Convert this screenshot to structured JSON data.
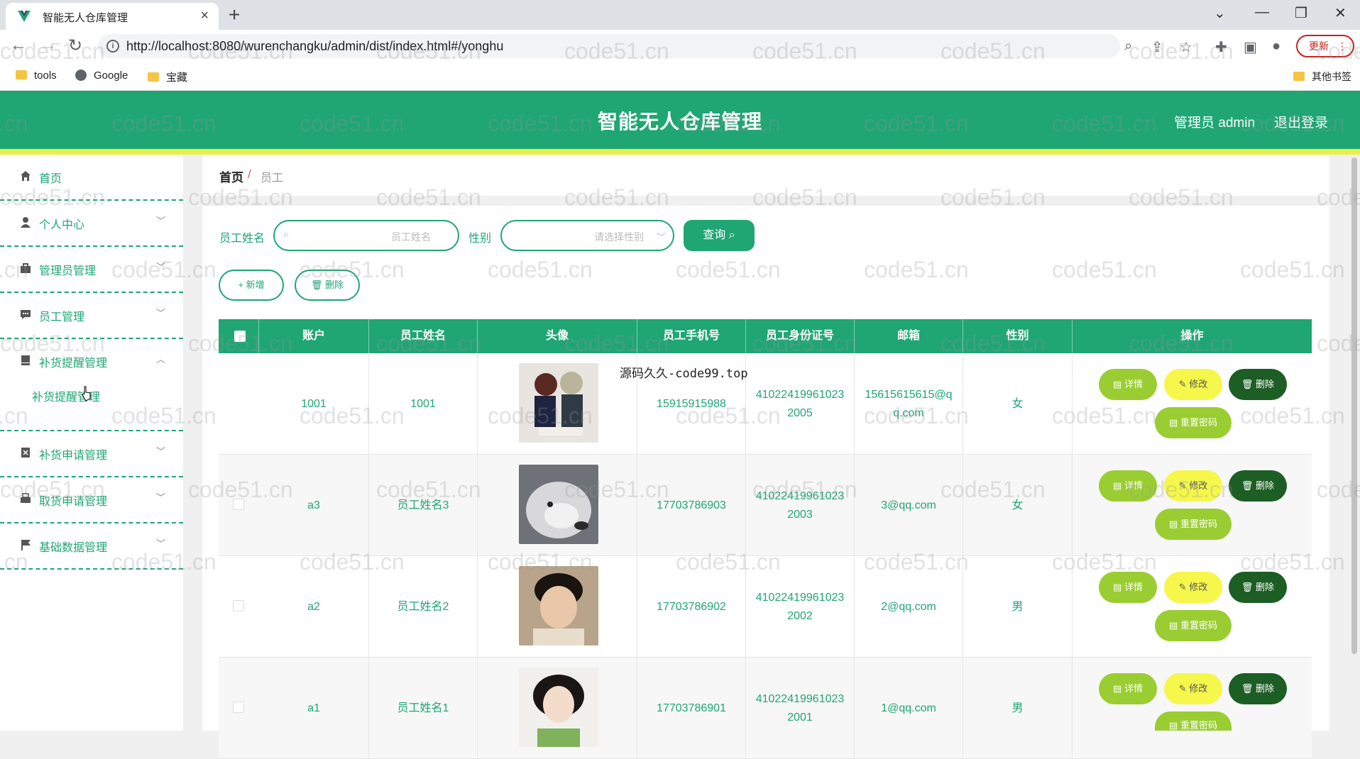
{
  "browser": {
    "tab_title": "智能无人仓库管理",
    "tab_close": "×",
    "new_tab": "+",
    "url": "http://localhost:8080/wurenchangku/admin/dist/index.html#/yonghu",
    "update_label": "更新",
    "menu_dots": "⋮",
    "bookmarks": [
      "tools",
      "Google",
      "宝藏"
    ],
    "other_bookmarks": "其他书签"
  },
  "header": {
    "title": "智能无人仓库管理",
    "user": "管理员 admin",
    "logout": "退出登录"
  },
  "sidebar": {
    "items": [
      {
        "label": "首页",
        "icon": "home-icon"
      },
      {
        "label": "个人中心",
        "icon": "user-icon"
      },
      {
        "label": "管理员管理",
        "icon": "briefcase-icon"
      },
      {
        "label": "员工管理",
        "icon": "chat-icon"
      },
      {
        "label": "补货提醒管理",
        "icon": "bookmark-icon"
      },
      {
        "label": "补货申请管理",
        "icon": "document-icon"
      },
      {
        "label": "取货申请管理",
        "icon": "printer-icon"
      },
      {
        "label": "基础数据管理",
        "icon": "flag-icon"
      }
    ],
    "sub_item": "补货提醒管理"
  },
  "breadcrumb": {
    "home": "首页",
    "sep": "/",
    "current": "员工"
  },
  "search": {
    "name_label": "员工姓名",
    "name_placeholder": "员工姓名",
    "gender_label": "性别",
    "gender_placeholder": "请选择性别",
    "query_button": "查询"
  },
  "actions": {
    "add": "+ 新增",
    "delete": "删除"
  },
  "table": {
    "columns": [
      "账户",
      "员工姓名",
      "头像",
      "员工手机号",
      "员工身份证号",
      "邮箱",
      "性别",
      "操作"
    ],
    "rows": [
      {
        "account": "1001",
        "name": "1001",
        "phone": "15915915988",
        "id_card": "410224199610232005",
        "id_l1": "41022419961023",
        "id_l2": "2005",
        "email_l1": "15615615615@q",
        "email_l2": "q.com",
        "gender": "女"
      },
      {
        "account": "a3",
        "name": "员工姓名3",
        "phone": "17703786903",
        "id_card": "410224199610232003",
        "id_l1": "41022419961023",
        "id_l2": "2003",
        "email_l1": "3@qq.com",
        "email_l2": "",
        "gender": "女"
      },
      {
        "account": "a2",
        "name": "员工姓名2",
        "phone": "17703786902",
        "id_card": "410224199610232002",
        "id_l1": "41022419961023",
        "id_l2": "2002",
        "email_l1": "2@qq.com",
        "email_l2": "",
        "gender": "男"
      },
      {
        "account": "a1",
        "name": "员工姓名1",
        "phone": "17703786901",
        "id_card": "410224199610232001",
        "id_l1": "41022419961023",
        "id_l2": "2001",
        "email_l1": "1@qq.com",
        "email_l2": "",
        "gender": "男"
      }
    ],
    "ops": {
      "detail": "详情",
      "edit": "修改",
      "delete": "删除",
      "reset": "重置密码"
    }
  },
  "overlay_text": "源码久久-code99.top",
  "watermark": "code51.cn",
  "colors": {
    "primary": "#1fa673",
    "accent_yellow": "#e9f04a",
    "detail_btn": "#9acd32",
    "edit_btn": "#f5f74a",
    "delete_btn": "#1c5e24"
  }
}
